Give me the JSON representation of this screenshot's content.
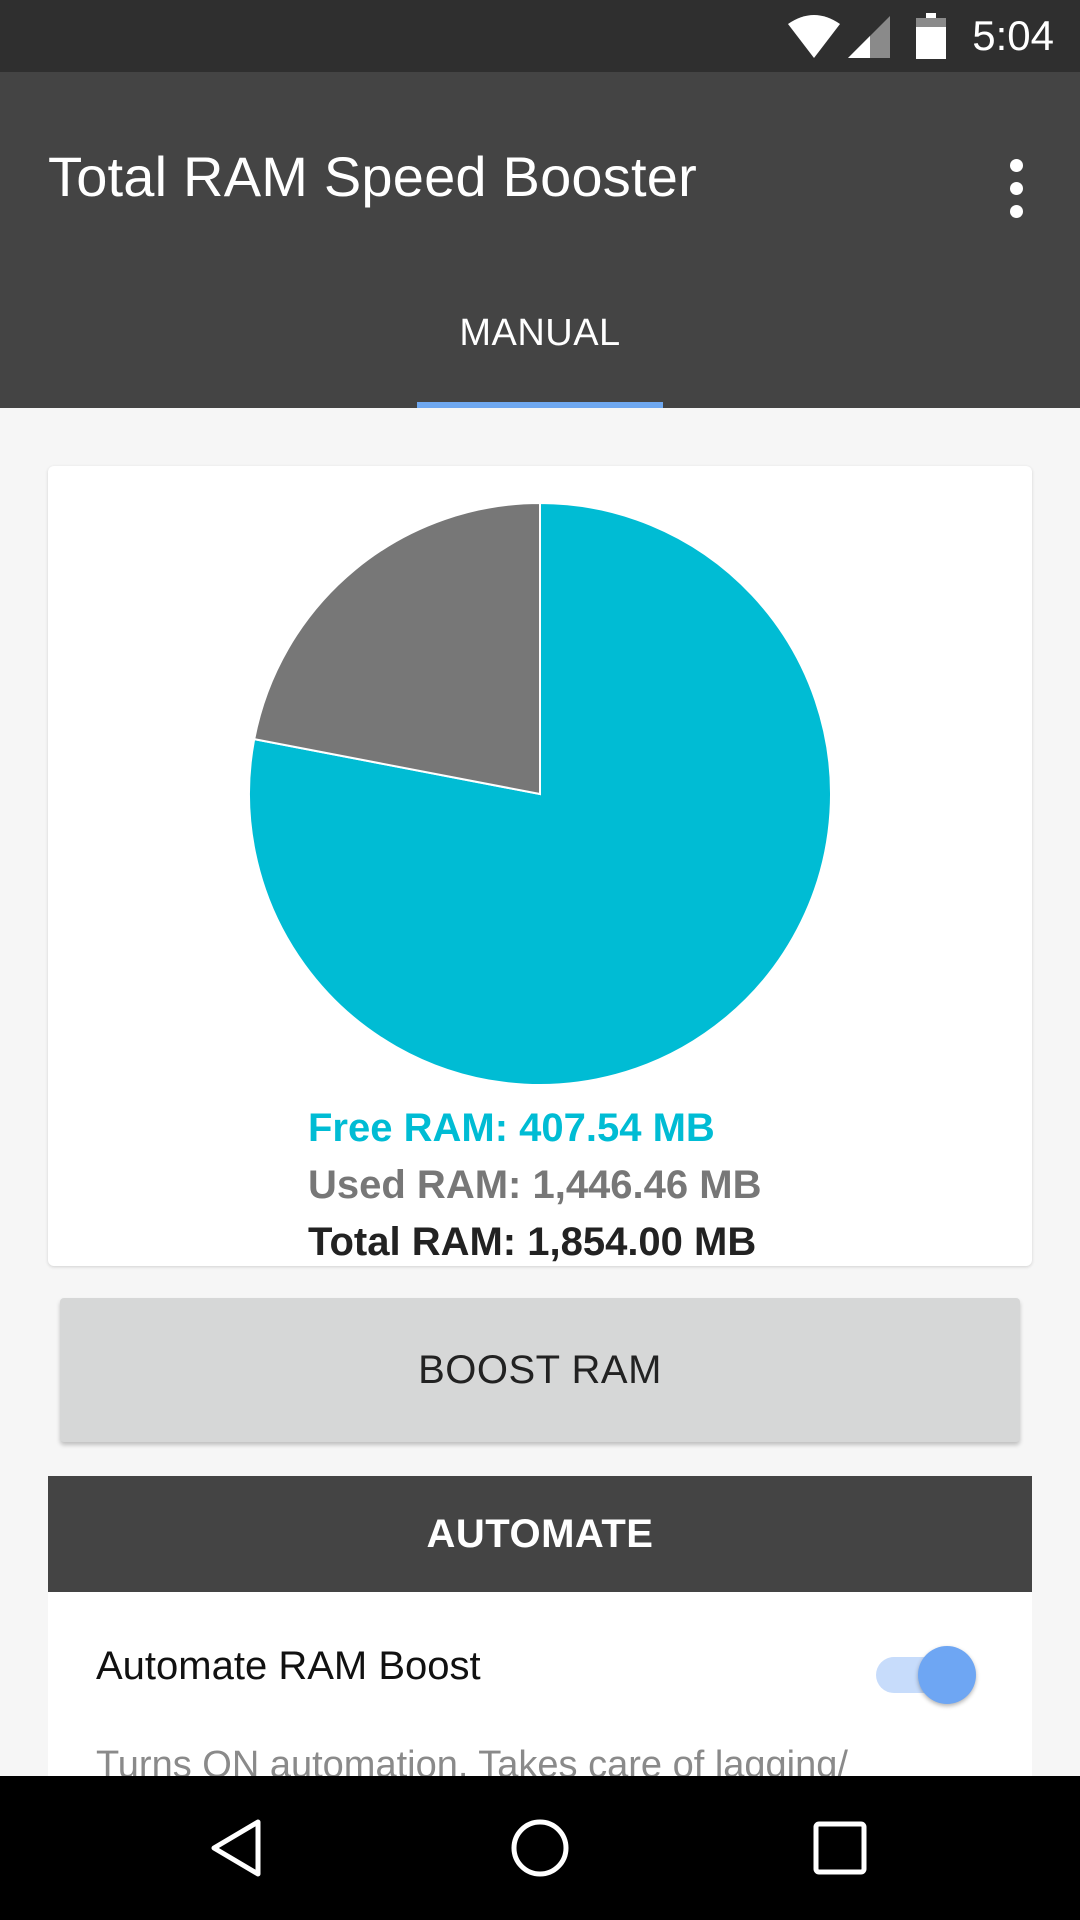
{
  "status_bar": {
    "time": "5:04",
    "icons": [
      "wifi-icon",
      "signal-icon",
      "battery-icon"
    ]
  },
  "app_bar": {
    "title": "Total RAM Speed Booster",
    "menu_icon": "more-vert-icon",
    "tabs": [
      {
        "label": "MANUAL",
        "selected": true
      }
    ]
  },
  "ram_card": {
    "free_label": "Free RAM: 407.54 MB",
    "used_label": "Used RAM: 1,446.46 MB",
    "total_label": "Total RAM: 1,854.00 MB"
  },
  "chart_data": {
    "type": "pie",
    "slices": [
      {
        "name": "Free RAM",
        "value": 407.54,
        "color": "#777777"
      },
      {
        "name": "Used RAM",
        "value": 1446.46,
        "color": "#00bcd4"
      }
    ],
    "total": 1854.0
  },
  "boost_button": {
    "label": "BOOST RAM"
  },
  "automate": {
    "header": "AUTOMATE",
    "toggle_label": "Automate RAM Boost",
    "toggle_on": true,
    "description": "Turns ON automation. Takes care of lagging/"
  },
  "nav_bar": {
    "icons": [
      "back-icon",
      "home-icon",
      "recents-icon"
    ]
  },
  "colors": {
    "accent": "#00bcd4",
    "app_bar": "#444444",
    "tab_indicator": "#6fa8f0",
    "toggle": "#6ea6f3"
  }
}
